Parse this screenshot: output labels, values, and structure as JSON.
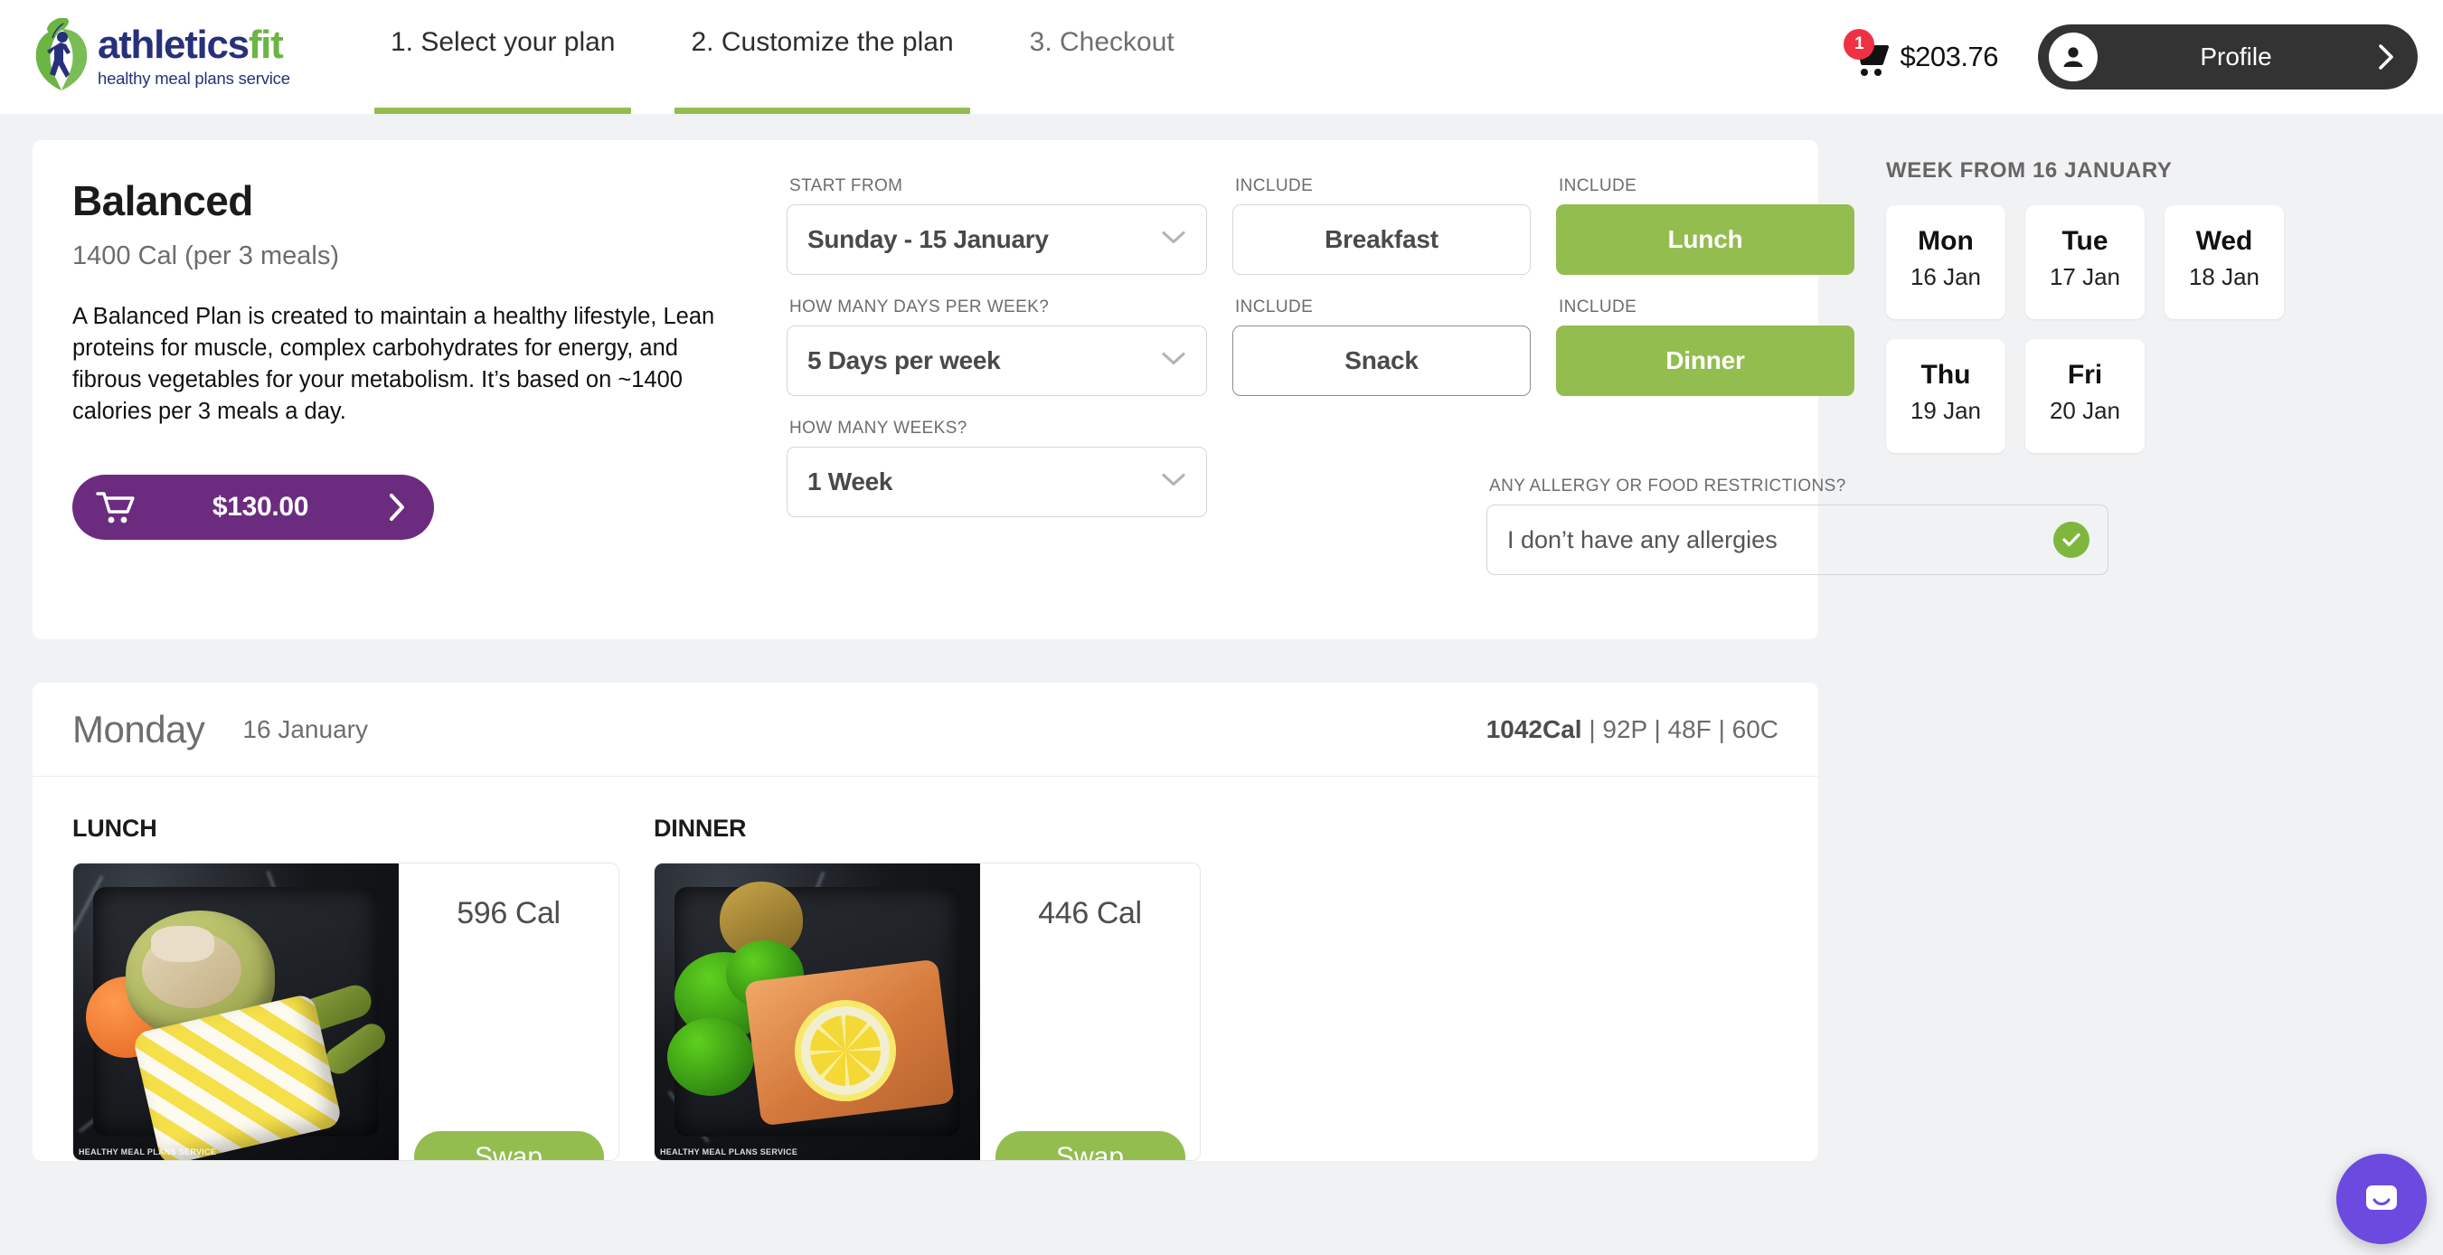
{
  "header": {
    "logo": {
      "word_primary": "athletics",
      "word_accent": "fit",
      "tagline": "healthy meal plans service",
      "icon": "runner-apple-logo"
    },
    "tabs": [
      {
        "label": "1. Select your plan",
        "state": "active"
      },
      {
        "label": "2. Customize the plan",
        "state": "active"
      },
      {
        "label": "3. Checkout",
        "state": "inactive"
      }
    ],
    "cart": {
      "badge_count": "1",
      "total": "$203.76",
      "icon": "cart-icon"
    },
    "profile": {
      "label": "Profile",
      "avatar_icon": "user-avatar-icon",
      "chevron": "chevron-right-icon"
    }
  },
  "plan": {
    "title": "Balanced",
    "calories": "1400 Cal (per 3 meals)",
    "description": "A Balanced Plan is created to maintain a healthy lifestyle, Lean proteins for muscle, complex carbohydrates for energy, and fibrous vegetables for your metabolism. It’s based on ~1400 calories per 3 meals a day.",
    "price_button": {
      "price": "$130.00",
      "cart_icon": "cart-icon",
      "chevron": "chevron-right-icon"
    },
    "fields": {
      "start_from": {
        "label": "START FROM",
        "value": "Sunday - 15 January"
      },
      "days_per_week": {
        "label": "HOW MANY DAYS PER WEEK?",
        "value": "5 Days per week"
      },
      "weeks": {
        "label": "HOW MANY WEEKS?",
        "value": "1 Week"
      },
      "allergy": {
        "label": "ANY ALLERGY OR FOOD RESTRICTIONS?",
        "value": "I don’t have any allergies",
        "status_icon": "check-circle-icon"
      }
    },
    "meal_toggles": [
      {
        "label_above": "INCLUDE",
        "name": "Breakfast",
        "selected": false
      },
      {
        "label_above": "INCLUDE",
        "name": "Lunch",
        "selected": true
      },
      {
        "label_above": "INCLUDE",
        "name": "Snack",
        "selected": false
      },
      {
        "label_above": "INCLUDE",
        "name": "Dinner",
        "selected": true
      }
    ]
  },
  "week_panel": {
    "title": "WEEK FROM 16 JANUARY",
    "days": [
      {
        "name": "Mon",
        "date": "16 Jan"
      },
      {
        "name": "Tue",
        "date": "17 Jan"
      },
      {
        "name": "Wed",
        "date": "18 Jan"
      },
      {
        "name": "Thu",
        "date": "19 Jan"
      },
      {
        "name": "Fri",
        "date": "20 Jan"
      }
    ]
  },
  "day_section": {
    "day_name": "Monday",
    "day_date": "16 January",
    "macros_calories": "1042Cal",
    "macros_rest": " | 92P | 48F | 60C",
    "meals": [
      {
        "label": "LUNCH",
        "calories": "596 Cal",
        "swap_label": "Swap",
        "photo_alt": "chicken-wrap-meal-photo",
        "watermark": "HEALTHY MEAL PLANS SERVICE"
      },
      {
        "label": "DINNER",
        "calories": "446 Cal",
        "swap_label": "Swap",
        "photo_alt": "salmon-broccoli-meal-photo",
        "watermark": "HEALTHY MEAL PLANS SERVICE"
      }
    ]
  },
  "chat_widget": {
    "icon": "chat-bubble-icon"
  },
  "colors": {
    "green": "#93bd4f",
    "purple": "#6b2c80",
    "chat_purple": "#6c4ae0",
    "badge_red": "#ef3144",
    "page_bg": "#f1f2f4",
    "logo_blue": "#27307a"
  }
}
